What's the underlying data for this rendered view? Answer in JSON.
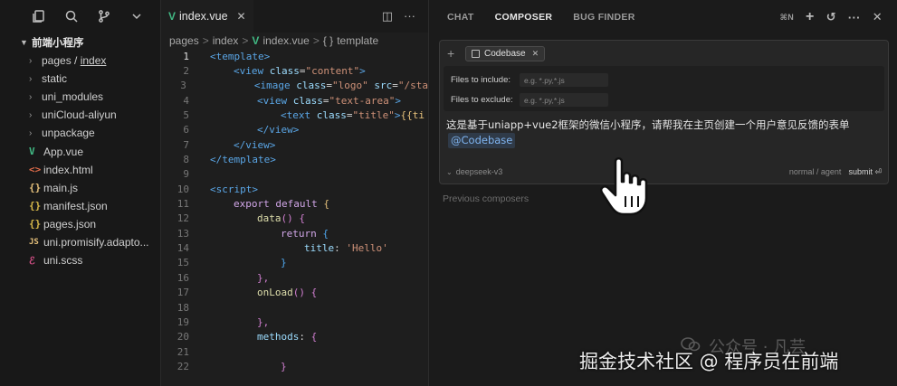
{
  "sidebar": {
    "root_label": "前端小程序",
    "items": [
      {
        "label_a": "pages",
        "label_b": "index",
        "type": "folder",
        "icon": "chevron-right-icon"
      },
      {
        "label": "static",
        "type": "folder",
        "icon": "chevron-right-icon"
      },
      {
        "label": "uni_modules",
        "type": "folder",
        "icon": "chevron-right-icon"
      },
      {
        "label": "uniCloud-aliyun",
        "type": "folder",
        "icon": "chevron-right-icon"
      },
      {
        "label": "unpackage",
        "type": "folder",
        "icon": "chevron-right-icon"
      },
      {
        "label": "App.vue",
        "type": "vue",
        "icon": "vue-file-icon"
      },
      {
        "label": "index.html",
        "type": "html",
        "icon": "html-file-icon"
      },
      {
        "label": "main.js",
        "type": "js",
        "icon": "json-braces-icon"
      },
      {
        "label": "manifest.json",
        "type": "json",
        "icon": "json-braces-icon"
      },
      {
        "label": "pages.json",
        "type": "json",
        "icon": "json-braces-icon"
      },
      {
        "label": "uni.promisify.adapto...",
        "type": "js",
        "icon": "js-file-icon"
      },
      {
        "label": "uni.scss",
        "type": "scss",
        "icon": "scss-file-icon"
      }
    ]
  },
  "editor": {
    "tab_label": "index.vue",
    "breadcrumb": {
      "p1": "pages",
      "p2": "index",
      "p3": "index.vue",
      "p4": "template",
      "sep": ">",
      "tmpl_icon": "{ }"
    },
    "line_numbers": [
      "1",
      "2",
      "3",
      "4",
      "5",
      "6",
      "7",
      "8",
      "9",
      "10",
      "11",
      "12",
      "13",
      "14",
      "15",
      "16",
      "17",
      "18",
      "19",
      "20",
      "21",
      "22"
    ],
    "code": {
      "l1": "<template>",
      "l2_open": "<view ",
      "l2_attr": "class",
      "l2_eq": "=",
      "l2_str": "\"content\"",
      "l2_close": ">",
      "l3_open": "<image ",
      "l3_attr": "class",
      "l3_eq": "=",
      "l3_str": "\"logo\"",
      "l3_attr2": " src",
      "l3_eq2": "=",
      "l3_str2": "\"/sta",
      "l4_open": "<view ",
      "l4_attr": "class",
      "l4_eq": "=",
      "l4_str": "\"text-area\"",
      "l4_close": ">",
      "l5_open": "<text ",
      "l5_attr": "class",
      "l5_eq": "=",
      "l5_str": "\"title\"",
      "l5_close": ">",
      "l5_tail": "{{ti",
      "l6": "</view>",
      "l7": "</view>",
      "l8": "</template>",
      "l10": "<script>",
      "l11_kw": "export default ",
      "l11_brace": "{",
      "l12_fn": "data",
      "l12_paren": "() ",
      "l12_brace": "{",
      "l13_kw": "return ",
      "l13_brace": "{",
      "l14_key": "title",
      "l14_colon": ": ",
      "l14_str": "'Hello'",
      "l15": "}",
      "l16": "},",
      "l17_fn": "onLoad",
      "l17_paren": "() ",
      "l17_brace": "{",
      "l19": "},",
      "l20_key": "methods",
      "l20_colon": ": ",
      "l20_brace": "{",
      "l22": "}"
    }
  },
  "panel": {
    "tabs": [
      "CHAT",
      "COMPOSER",
      "BUG FINDER"
    ],
    "active_tab": "COMPOSER",
    "shortcut": "⌘N",
    "composer": {
      "chip_label": "Codebase",
      "include_label": "Files to include:",
      "include_placeholder": "e.g. *.py,*.js",
      "exclude_label": "Files to exclude:",
      "exclude_placeholder": "e.g. *.py,*.js",
      "prompt_text": "这是基于uniapp+vue2框架的微信小程序，请帮我在主页创建一个用户意见反馈的表单",
      "mention": "@Codebase",
      "model": "deepseek-v3",
      "mode": "normal / agent",
      "submit_label": "submit ⏎"
    },
    "previous_label": "Previous composers"
  },
  "watermark": {
    "text": "掘金技术社区 @ 程序员在前端",
    "bg_text": "公众号 · 凡芸"
  },
  "colors": {
    "vue_green": "#41b883",
    "mention_blue": "#7fb4f0",
    "background": "#1e1e1e"
  }
}
